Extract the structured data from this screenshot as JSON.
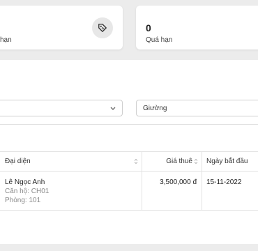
{
  "stats": {
    "left_label": "hạn",
    "right_value": "0",
    "right_label": "Quá hạn"
  },
  "filters": {
    "left_value": "",
    "right_value": "Giường"
  },
  "table": {
    "headers": [
      "Đại diện",
      "Giá thuê",
      "Ngày bắt đầu"
    ],
    "rows": [
      {
        "name": "Lê Ngọc Anh",
        "apartment": "Căn hộ: CH01",
        "room": "Phòng: 101",
        "price": "3,500,000 đ",
        "start_date": "15-11-2022"
      }
    ]
  }
}
